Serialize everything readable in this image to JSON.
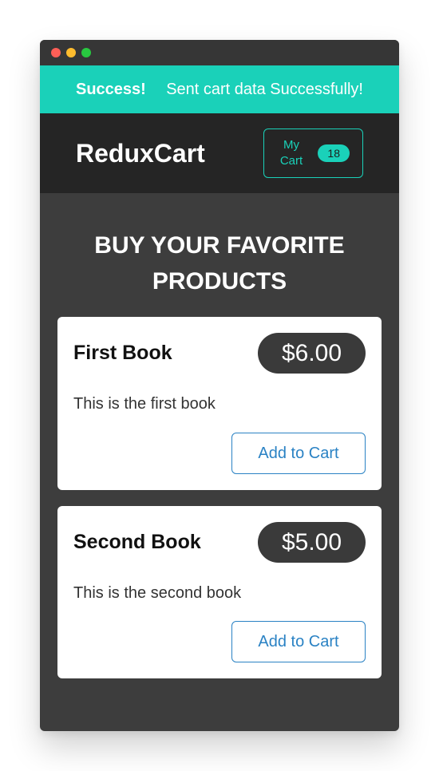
{
  "notification": {
    "status": "Success!",
    "message": "Sent cart data Successfully!"
  },
  "header": {
    "logo": "ReduxCart",
    "cart_label": "My Cart",
    "cart_count": "18"
  },
  "main": {
    "title": "BUY YOUR FAVORITE PRODUCTS",
    "products": [
      {
        "title": "First Book",
        "price": "$6.00",
        "description": "This is the first book",
        "button_label": "Add to Cart"
      },
      {
        "title": "Second Book",
        "price": "$5.00",
        "description": "This is the second book",
        "button_label": "Add to Cart"
      }
    ]
  },
  "colors": {
    "accent": "#1ad1b9",
    "header_bg": "#252525",
    "body_bg": "#3d3d3d",
    "button_text": "#2a82c4"
  }
}
